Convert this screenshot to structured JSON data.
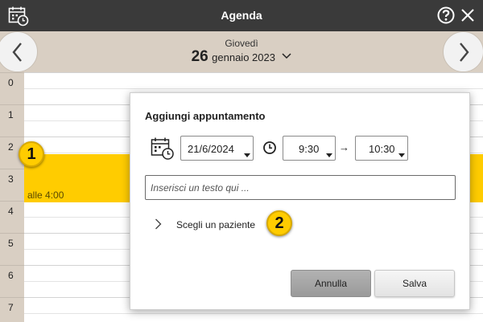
{
  "app": {
    "title": "Agenda"
  },
  "date_header": {
    "weekday": "Giovedì",
    "day": "26",
    "month_year": "gennaio 2023"
  },
  "hours": [
    "0",
    "1",
    "2",
    "3",
    "4",
    "5",
    "6",
    "7"
  ],
  "appointment": {
    "label": "alle 4:00",
    "color": "#ffcc00"
  },
  "badges": {
    "one": "1",
    "two": "2"
  },
  "dialog": {
    "title": "Aggiungi appuntamento",
    "date_value": "21/6/2024",
    "start_time": "9:30",
    "arrow": "→",
    "end_time": "10:30",
    "text_placeholder": "Inserisci un testo qui ...",
    "choose_patient_label": "Scegli un paziente",
    "cancel_label": "Annulla",
    "save_label": "Salva"
  },
  "colors": {
    "titlebar": "#3a3a3a",
    "header": "#d9cfc3",
    "accent": "#ffcc00"
  },
  "icons": [
    "calendar-clock-icon",
    "help-icon",
    "close-icon",
    "chevron-left-icon",
    "chevron-right-icon",
    "chevron-down-icon",
    "clock-icon",
    "chevron-right-small-icon"
  ]
}
